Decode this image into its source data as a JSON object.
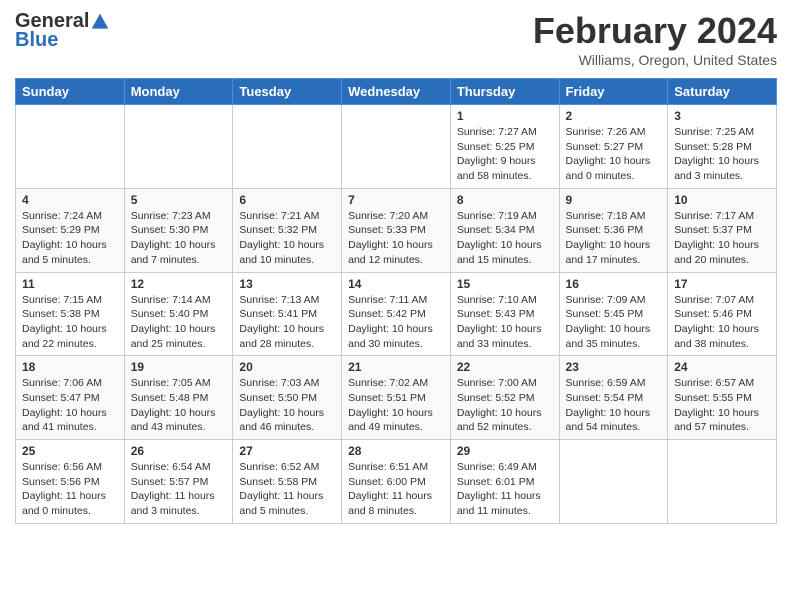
{
  "logo": {
    "general": "General",
    "blue": "Blue"
  },
  "header": {
    "title": "February 2024",
    "subtitle": "Williams, Oregon, United States"
  },
  "weekdays": [
    "Sunday",
    "Monday",
    "Tuesday",
    "Wednesday",
    "Thursday",
    "Friday",
    "Saturday"
  ],
  "weeks": [
    [
      {
        "day": "",
        "info": ""
      },
      {
        "day": "",
        "info": ""
      },
      {
        "day": "",
        "info": ""
      },
      {
        "day": "",
        "info": ""
      },
      {
        "day": "1",
        "info": "Sunrise: 7:27 AM\nSunset: 5:25 PM\nDaylight: 9 hours\nand 58 minutes."
      },
      {
        "day": "2",
        "info": "Sunrise: 7:26 AM\nSunset: 5:27 PM\nDaylight: 10 hours\nand 0 minutes."
      },
      {
        "day": "3",
        "info": "Sunrise: 7:25 AM\nSunset: 5:28 PM\nDaylight: 10 hours\nand 3 minutes."
      }
    ],
    [
      {
        "day": "4",
        "info": "Sunrise: 7:24 AM\nSunset: 5:29 PM\nDaylight: 10 hours\nand 5 minutes."
      },
      {
        "day": "5",
        "info": "Sunrise: 7:23 AM\nSunset: 5:30 PM\nDaylight: 10 hours\nand 7 minutes."
      },
      {
        "day": "6",
        "info": "Sunrise: 7:21 AM\nSunset: 5:32 PM\nDaylight: 10 hours\nand 10 minutes."
      },
      {
        "day": "7",
        "info": "Sunrise: 7:20 AM\nSunset: 5:33 PM\nDaylight: 10 hours\nand 12 minutes."
      },
      {
        "day": "8",
        "info": "Sunrise: 7:19 AM\nSunset: 5:34 PM\nDaylight: 10 hours\nand 15 minutes."
      },
      {
        "day": "9",
        "info": "Sunrise: 7:18 AM\nSunset: 5:36 PM\nDaylight: 10 hours\nand 17 minutes."
      },
      {
        "day": "10",
        "info": "Sunrise: 7:17 AM\nSunset: 5:37 PM\nDaylight: 10 hours\nand 20 minutes."
      }
    ],
    [
      {
        "day": "11",
        "info": "Sunrise: 7:15 AM\nSunset: 5:38 PM\nDaylight: 10 hours\nand 22 minutes."
      },
      {
        "day": "12",
        "info": "Sunrise: 7:14 AM\nSunset: 5:40 PM\nDaylight: 10 hours\nand 25 minutes."
      },
      {
        "day": "13",
        "info": "Sunrise: 7:13 AM\nSunset: 5:41 PM\nDaylight: 10 hours\nand 28 minutes."
      },
      {
        "day": "14",
        "info": "Sunrise: 7:11 AM\nSunset: 5:42 PM\nDaylight: 10 hours\nand 30 minutes."
      },
      {
        "day": "15",
        "info": "Sunrise: 7:10 AM\nSunset: 5:43 PM\nDaylight: 10 hours\nand 33 minutes."
      },
      {
        "day": "16",
        "info": "Sunrise: 7:09 AM\nSunset: 5:45 PM\nDaylight: 10 hours\nand 35 minutes."
      },
      {
        "day": "17",
        "info": "Sunrise: 7:07 AM\nSunset: 5:46 PM\nDaylight: 10 hours\nand 38 minutes."
      }
    ],
    [
      {
        "day": "18",
        "info": "Sunrise: 7:06 AM\nSunset: 5:47 PM\nDaylight: 10 hours\nand 41 minutes."
      },
      {
        "day": "19",
        "info": "Sunrise: 7:05 AM\nSunset: 5:48 PM\nDaylight: 10 hours\nand 43 minutes."
      },
      {
        "day": "20",
        "info": "Sunrise: 7:03 AM\nSunset: 5:50 PM\nDaylight: 10 hours\nand 46 minutes."
      },
      {
        "day": "21",
        "info": "Sunrise: 7:02 AM\nSunset: 5:51 PM\nDaylight: 10 hours\nand 49 minutes."
      },
      {
        "day": "22",
        "info": "Sunrise: 7:00 AM\nSunset: 5:52 PM\nDaylight: 10 hours\nand 52 minutes."
      },
      {
        "day": "23",
        "info": "Sunrise: 6:59 AM\nSunset: 5:54 PM\nDaylight: 10 hours\nand 54 minutes."
      },
      {
        "day": "24",
        "info": "Sunrise: 6:57 AM\nSunset: 5:55 PM\nDaylight: 10 hours\nand 57 minutes."
      }
    ],
    [
      {
        "day": "25",
        "info": "Sunrise: 6:56 AM\nSunset: 5:56 PM\nDaylight: 11 hours\nand 0 minutes."
      },
      {
        "day": "26",
        "info": "Sunrise: 6:54 AM\nSunset: 5:57 PM\nDaylight: 11 hours\nand 3 minutes."
      },
      {
        "day": "27",
        "info": "Sunrise: 6:52 AM\nSunset: 5:58 PM\nDaylight: 11 hours\nand 5 minutes."
      },
      {
        "day": "28",
        "info": "Sunrise: 6:51 AM\nSunset: 6:00 PM\nDaylight: 11 hours\nand 8 minutes."
      },
      {
        "day": "29",
        "info": "Sunrise: 6:49 AM\nSunset: 6:01 PM\nDaylight: 11 hours\nand 11 minutes."
      },
      {
        "day": "",
        "info": ""
      },
      {
        "day": "",
        "info": ""
      }
    ]
  ]
}
